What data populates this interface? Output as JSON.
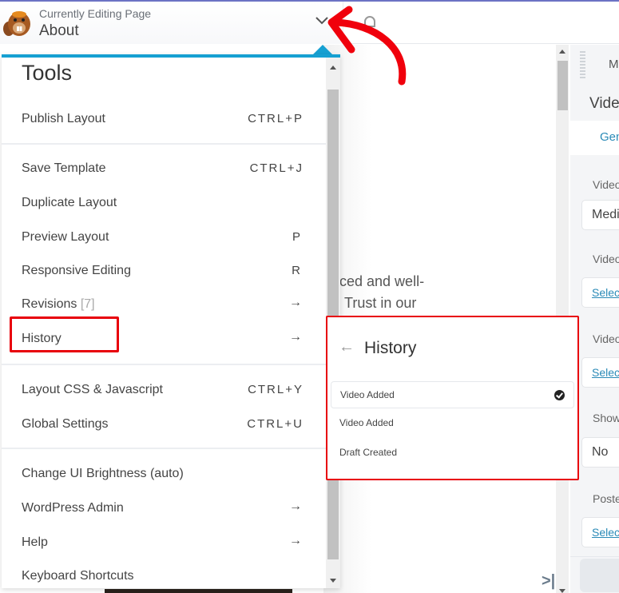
{
  "header": {
    "editing_label": "Currently Editing Page",
    "page_name": "About"
  },
  "tools_menu": {
    "title": "Tools",
    "groups": [
      [
        {
          "label": "Publish Layout",
          "shortcut": "CTRL+P"
        }
      ],
      [
        {
          "label": "Save Template",
          "shortcut": "CTRL+J"
        },
        {
          "label": "Duplicate Layout",
          "shortcut": ""
        },
        {
          "label": "Preview Layout",
          "shortcut": "P"
        },
        {
          "label": "Responsive Editing",
          "shortcut": "R"
        },
        {
          "label": "Revisions",
          "count": "[7]",
          "shortcut": "→"
        },
        {
          "label": "History",
          "shortcut": "→"
        }
      ],
      [
        {
          "label": "Layout CSS & Javascript",
          "shortcut": "CTRL+Y"
        },
        {
          "label": "Global Settings",
          "shortcut": "CTRL+U"
        }
      ],
      [
        {
          "label": "Change UI Brightness (auto)",
          "shortcut": ""
        },
        {
          "label": "WordPress Admin",
          "shortcut": "→"
        },
        {
          "label": "Help",
          "shortcut": "→"
        },
        {
          "label": "Keyboard Shortcuts",
          "shortcut": ""
        }
      ]
    ]
  },
  "history_panel": {
    "back_icon": "←",
    "title": "History",
    "items": [
      {
        "label": "Video Added",
        "active": true
      },
      {
        "label": "Video Added",
        "active": false
      },
      {
        "label": "Draft Created",
        "active": false
      }
    ]
  },
  "canvas": {
    "text_lines": [
      "ced and well-",
      "Trust in our"
    ]
  },
  "settings_panel": {
    "top_label": "M",
    "title": "Vide",
    "tab": "Gen",
    "fields": [
      {
        "label": "Video",
        "value": "Medi",
        "is_link": false
      },
      {
        "label": "Video",
        "value": "Select",
        "is_link": true
      },
      {
        "label": "Video",
        "value": "Select",
        "is_link": true
      },
      {
        "label": "Show",
        "value": "No",
        "is_link": false
      },
      {
        "label": "Poste",
        "value": "Select",
        "is_link": true
      }
    ]
  },
  "colors": {
    "accent": "#16a0d2",
    "annotation_red": "#e8000b",
    "link": "#2a8ab7"
  }
}
